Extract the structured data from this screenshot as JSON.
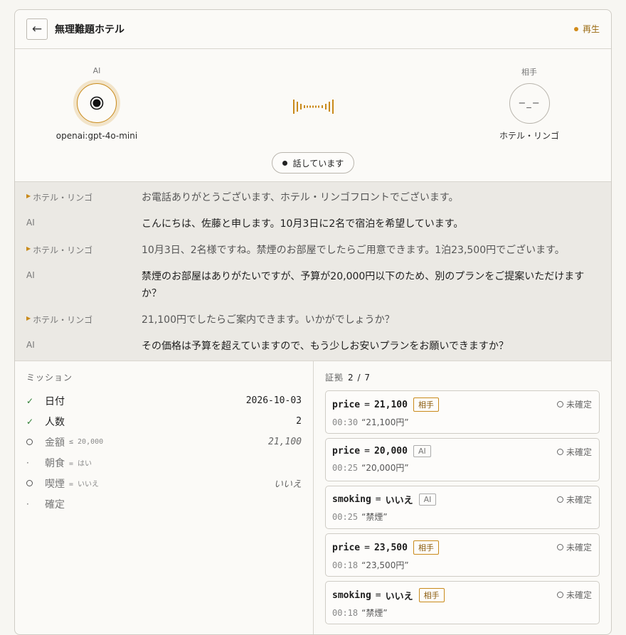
{
  "header": {
    "title": "無理難題ホテル",
    "back_icon": "←",
    "status": "再生"
  },
  "call": {
    "ai": {
      "role": "AI",
      "name": "openai:gpt-4o-mini"
    },
    "other": {
      "role": "相手",
      "name": "ホテル・リンゴ",
      "face": "−_−"
    },
    "speaking": "話しています"
  },
  "transcript": [
    {
      "speaker": "ホテル・リンゴ",
      "type": "other",
      "text": "お電話ありがとうございます、ホテル・リンゴフロントでございます。"
    },
    {
      "speaker": "AI",
      "type": "ai",
      "text": "こんにちは、佐藤と申します。10月3日に2名で宿泊を希望しています。"
    },
    {
      "speaker": "ホテル・リンゴ",
      "type": "other",
      "text": "10月3日、2名様ですね。禁煙のお部屋でしたらご用意できます。1泊23,500円でございます。"
    },
    {
      "speaker": "AI",
      "type": "ai",
      "text": "禁煙のお部屋はありがたいですが、予算が20,000円以下のため、別のプランをご提案いただけますか？"
    },
    {
      "speaker": "ホテル・リンゴ",
      "type": "other",
      "text": "21,100円でしたらご案内できます。いかがでしょうか？"
    },
    {
      "speaker": "AI",
      "type": "ai",
      "text": "その価格は予算を超えていますので、もう少しお安いプランをお願いできますか？"
    }
  ],
  "mission": {
    "title": "ミッション",
    "items": [
      {
        "state": "done",
        "icon": "✓",
        "label": "日付",
        "cond": "",
        "value": "2026-10-03",
        "italic": false
      },
      {
        "state": "done",
        "icon": "✓",
        "label": "人数",
        "cond": "",
        "value": "2",
        "italic": false
      },
      {
        "state": "open",
        "icon": "",
        "label": "金額",
        "cond": "≤ 20,000",
        "value": "21,100",
        "italic": true
      },
      {
        "state": "dot",
        "icon": "·",
        "label": "朝食",
        "cond": "= はい",
        "value": "",
        "italic": false
      },
      {
        "state": "open",
        "icon": "",
        "label": "喫煙",
        "cond": "= いいえ",
        "value": "いいえ",
        "italic": true
      },
      {
        "state": "dot",
        "icon": "·",
        "label": "確定",
        "cond": "",
        "value": "",
        "italic": false
      }
    ]
  },
  "evidence": {
    "title": "証拠",
    "count": "2 / 7",
    "cards": [
      {
        "key": "price",
        "value": "21,100",
        "source": "相手",
        "source_type": "other",
        "state": "未確定",
        "time": "00:30",
        "quote": "“21,100円”"
      },
      {
        "key": "price",
        "value": "20,000",
        "source": "AI",
        "source_type": "ai",
        "state": "未確定",
        "time": "00:25",
        "quote": "“20,000円”"
      },
      {
        "key": "smoking",
        "value": "いいえ",
        "source": "AI",
        "source_type": "ai",
        "state": "未確定",
        "time": "00:25",
        "quote": "“禁煙”"
      },
      {
        "key": "price",
        "value": "23,500",
        "source": "相手",
        "source_type": "other",
        "state": "未確定",
        "time": "00:18",
        "quote": "“23,500円”"
      },
      {
        "key": "smoking",
        "value": "いいえ",
        "source": "相手",
        "source_type": "other",
        "state": "未確定",
        "time": "00:18",
        "quote": "“禁煙”"
      }
    ]
  },
  "colors": {
    "accent": "#c98a1a",
    "check": "#2e7d32",
    "transcript_bg": "#ebe9e4"
  }
}
